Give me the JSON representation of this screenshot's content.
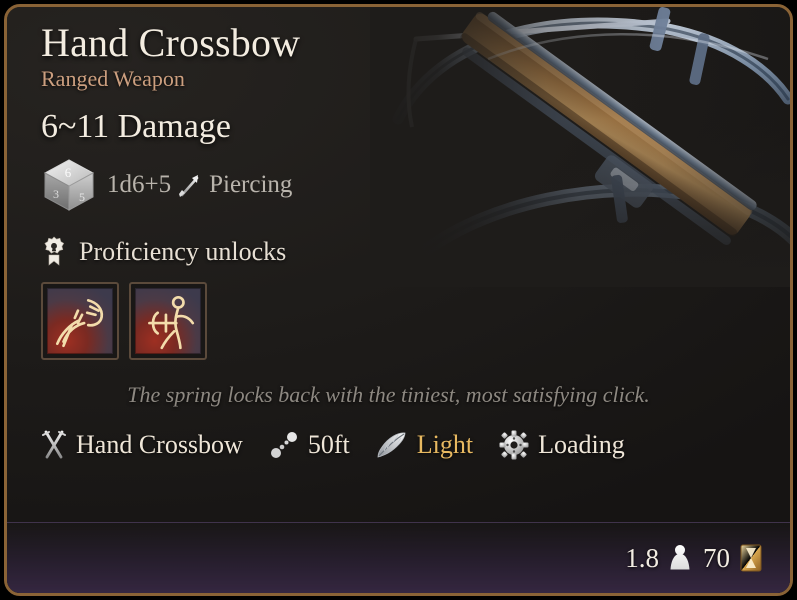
{
  "tooltip": {
    "title": "Hand Crossbow",
    "subtitle": "Ranged Weapon",
    "damage_summary": "6~11 Damage",
    "damage_dice": "1d6+5",
    "damage_type": "Piercing",
    "proficiency_header": "Proficiency unlocks",
    "flavour_text": "The spring locks back with the tiniest, most satisfying click.",
    "skills": [
      {
        "name": "skill-icon-beast",
        "tooltip": ""
      },
      {
        "name": "skill-icon-crossbow-shot",
        "tooltip": ""
      }
    ],
    "properties": [
      {
        "icon": "crossed-swords-icon",
        "label": "Hand Crossbow",
        "style": "normal"
      },
      {
        "icon": "range-dots-icon",
        "label": "50ft",
        "style": "normal"
      },
      {
        "icon": "feather-icon",
        "label": "Light",
        "style": "gold"
      },
      {
        "icon": "gear-icon",
        "label": "Loading",
        "style": "normal"
      }
    ],
    "footer": {
      "weight_value": "1.8",
      "weight_icon": "weight-icon",
      "price_value": "70",
      "price_icon": "gold-coin-icon"
    },
    "icons": {
      "dice": "dice-cube-icon",
      "piercing": "piercing-arrow-icon",
      "proficiency": "award-medal-icon",
      "artwork": "hand-crossbow-artwork"
    },
    "colors": {
      "border": "#8a6336",
      "panel": "#1e1c1a",
      "title": "#f3ece0",
      "subtitle": "#cc9f7f",
      "gold_text": "#e8b961",
      "muted_text": "#8d8881",
      "footer_tint": "#372844"
    }
  }
}
